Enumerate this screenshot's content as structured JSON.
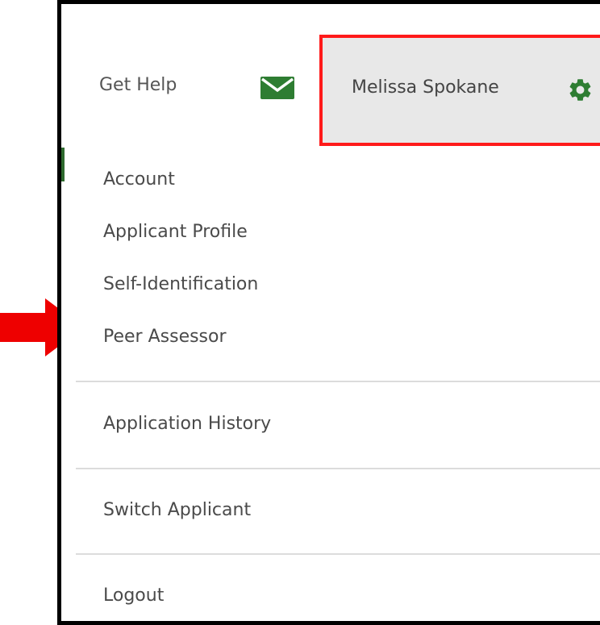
{
  "header": {
    "help_label": "Get Help",
    "mail_icon": "envelope-icon",
    "user_name": "Melissa Spokane",
    "settings_icon": "gear-icon"
  },
  "menu": {
    "items": [
      {
        "label": "Account"
      },
      {
        "label": "Applicant Profile"
      },
      {
        "label": "Self-Identification"
      },
      {
        "label": "Peer Assessor"
      },
      {
        "label": "Application History"
      },
      {
        "label": "Switch Applicant"
      },
      {
        "label": "Logout"
      }
    ]
  },
  "colors": {
    "accent_green": "#2e7d32",
    "highlight_red": "#ff1a1a",
    "arrow_red": "#ee0000"
  }
}
